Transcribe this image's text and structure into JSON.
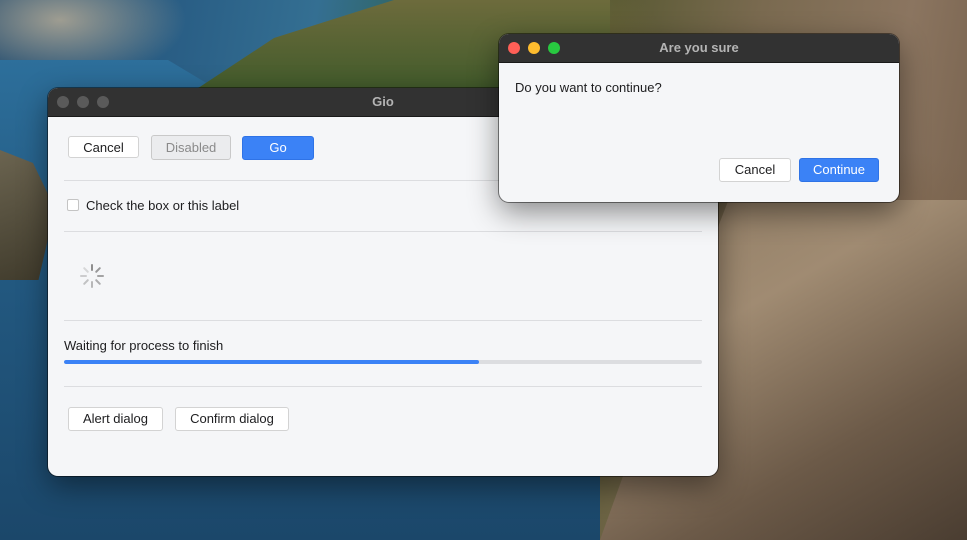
{
  "main_window": {
    "title": "Gio",
    "buttons": {
      "cancel": "Cancel",
      "disabled": "Disabled",
      "go": "Go"
    },
    "checkbox": {
      "label": "Check the box or this label",
      "checked": false
    },
    "progress": {
      "label": "Waiting for process to finish",
      "fraction": 0.65
    },
    "dialog_buttons": {
      "alert": "Alert dialog",
      "confirm": "Confirm dialog"
    }
  },
  "dialog": {
    "title": "Are you sure",
    "message": "Do you want to continue?",
    "cancel_label": "Cancel",
    "continue_label": "Continue"
  },
  "colors": {
    "accent": "#3b82f6",
    "titlebar": "#323232",
    "window_bg": "#f5f6f8"
  },
  "icons": {
    "spinner": "loading-spinner-icon"
  }
}
